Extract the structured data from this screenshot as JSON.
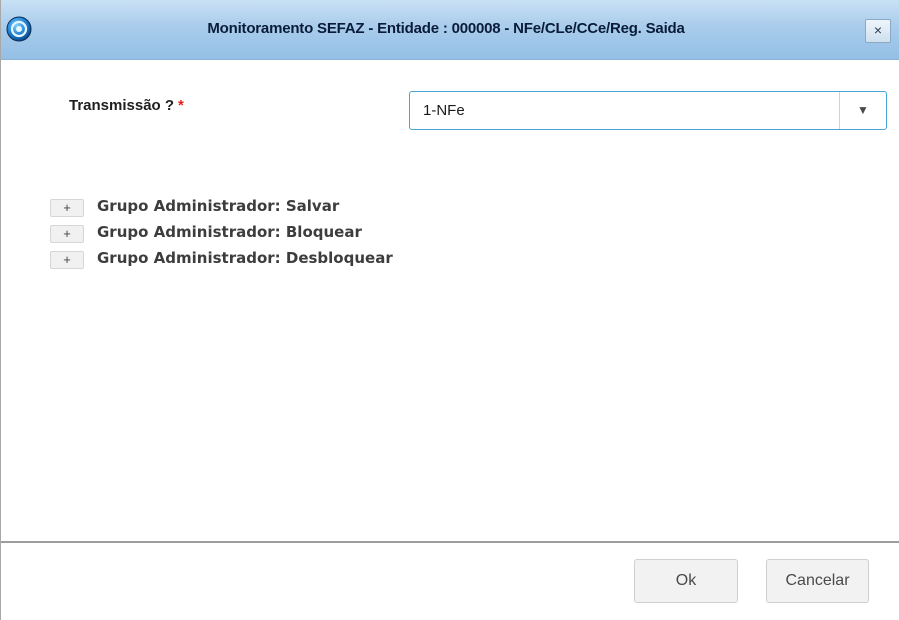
{
  "window": {
    "title": "Monitoramento SEFAZ - Entidade : 000008 - NFe/CLe/CCe/Reg. Saida",
    "close_glyph": "×",
    "app_icon": "totvs-app-icon",
    "close_icon": "close-icon"
  },
  "form": {
    "transmission": {
      "label": "Transmissão ?",
      "required_mark": "*",
      "selected_value": "1-NFe",
      "arrow_glyph": "▼",
      "arrow_icon": "chevron-down-icon"
    }
  },
  "groups": [
    {
      "expander": "+",
      "label": "Grupo Administrador: Salvar"
    },
    {
      "expander": "+",
      "label": "Grupo Administrador: Bloquear"
    },
    {
      "expander": "+",
      "label": "Grupo Administrador: Desbloquear"
    }
  ],
  "footer": {
    "ok_label": "Ok",
    "cancel_label": "Cancelar"
  },
  "colors": {
    "titlebar": "#a9cceb",
    "select_border": "#4aa3d9",
    "required": "#e0201a"
  }
}
